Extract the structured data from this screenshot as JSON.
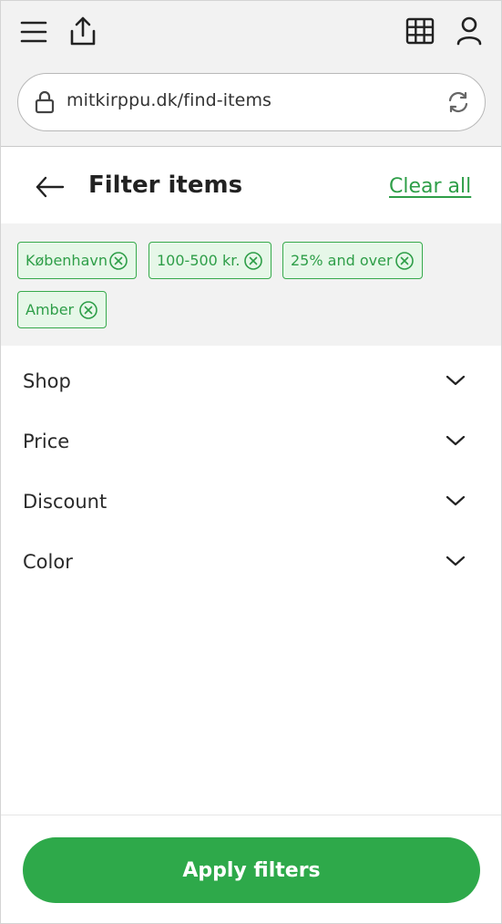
{
  "browser": {
    "url": "mitkirppu.dk/find-items",
    "icons": [
      "menu-icon",
      "share-icon",
      "grid-icon",
      "user-icon",
      "lock-icon",
      "reload-icon"
    ]
  },
  "header": {
    "title": "Filter items",
    "clear_all": "Clear all",
    "back_icon": "arrow-left-icon"
  },
  "active_filters": [
    {
      "label": "København"
    },
    {
      "label": "100-500 kr."
    },
    {
      "label": "25% and over"
    },
    {
      "label": "Amber"
    }
  ],
  "filter_sections": [
    {
      "label": "Shop"
    },
    {
      "label": "Price"
    },
    {
      "label": "Discount"
    },
    {
      "label": "Color"
    }
  ],
  "footer": {
    "apply_label": "Apply filters"
  },
  "colors": {
    "accent": "#2ea94a",
    "chip_bg": "#e6f7e8",
    "chrome_bg": "#f2f2f2"
  }
}
